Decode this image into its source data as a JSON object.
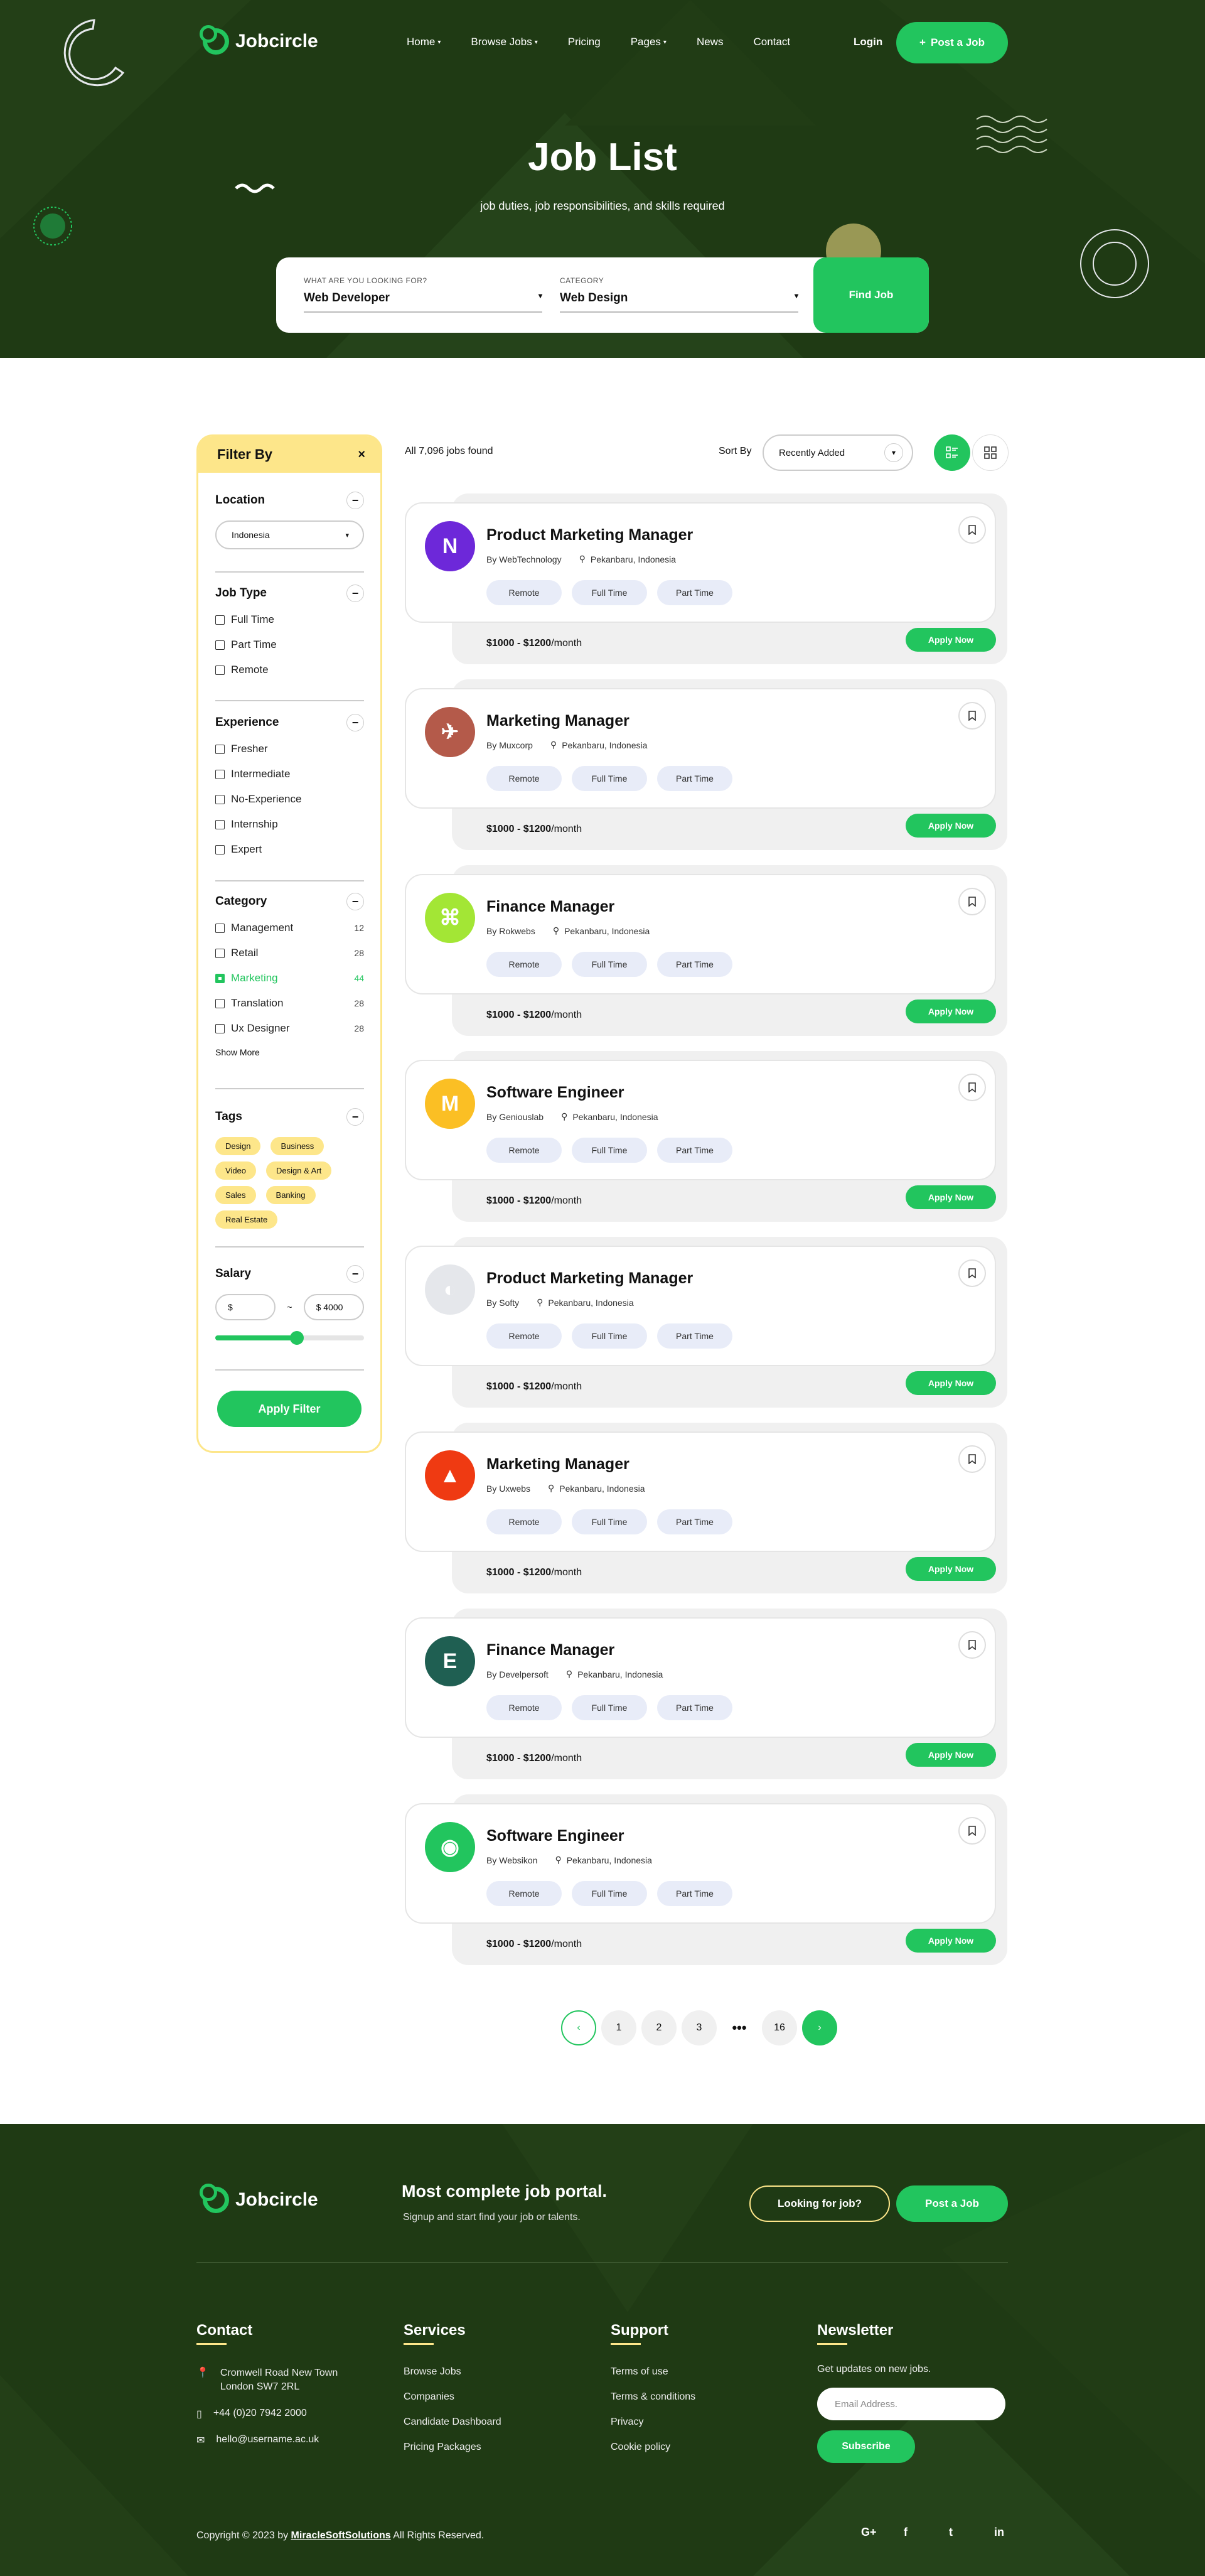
{
  "brand": "Jobcircle",
  "nav": {
    "items": [
      "Home",
      "Browse Jobs",
      "Pricing",
      "Pages",
      "News",
      "Contact"
    ],
    "has_dropdown": [
      true,
      true,
      false,
      true,
      false,
      false
    ],
    "login": "Login",
    "post_job": "Post a Job"
  },
  "hero": {
    "title": "Job List",
    "subtitle": "job duties, job responsibilities, and skills required"
  },
  "search": {
    "what_label": "WHAT ARE YOU LOOKING FOR?",
    "what_value": "Web Developer",
    "category_label": "CATEGORY",
    "category_value": "Web Design",
    "find_button": "Find Job"
  },
  "filter": {
    "title": "Filter By",
    "location": {
      "heading": "Location",
      "value": "Indonesia"
    },
    "job_type": {
      "heading": "Job Type",
      "options": [
        "Full Time",
        "Part Time",
        "Remote"
      ]
    },
    "experience": {
      "heading": "Experience",
      "options": [
        "Fresher",
        "Intermediate",
        "No-Experience",
        "Internship",
        "Expert"
      ]
    },
    "category": {
      "heading": "Category",
      "options": [
        {
          "label": "Management",
          "count": "12",
          "checked": false
        },
        {
          "label": "Retail",
          "count": "28",
          "checked": false
        },
        {
          "label": "Marketing",
          "count": "44",
          "checked": true
        },
        {
          "label": "Translation",
          "count": "28",
          "checked": false
        },
        {
          "label": "Ux Designer",
          "count": "28",
          "checked": false
        }
      ],
      "show_more": "Show More"
    },
    "tags": {
      "heading": "Tags",
      "items": [
        "Design",
        "Business",
        "Video",
        "Design & Art",
        "Sales",
        "Banking",
        "Real Estate"
      ]
    },
    "salary": {
      "heading": "Salary",
      "min": "$",
      "separator": "~",
      "max": "$ 4000",
      "range_fraction": 0.55
    },
    "apply": "Apply Filter"
  },
  "results": {
    "count_text": "All 7,096 jobs found",
    "sort_label": "Sort By",
    "sort_value": "Recently Added"
  },
  "jobs": [
    {
      "title": "Product Marketing Manager",
      "company": "By WebTechnology",
      "location": "Pekanbaru, Indonesia",
      "tags": [
        "Remote",
        "Full Time",
        "Part Time"
      ],
      "salary_range": "$1000 - $1200",
      "salary_unit": "/month",
      "apply": "Apply Now",
      "logo_color": "#6d28d9",
      "logo_glyph": "N"
    },
    {
      "title": "Marketing Manager",
      "company": "By Muxcorp",
      "location": "Pekanbaru, Indonesia",
      "tags": [
        "Remote",
        "Full Time",
        "Part Time"
      ],
      "salary_range": "$1000 - $1200",
      "salary_unit": "/month",
      "apply": "Apply Now",
      "logo_color": "#b45a4a",
      "logo_glyph": "✈"
    },
    {
      "title": "Finance Manager",
      "company": "By Rokwebs",
      "location": "Pekanbaru, Indonesia",
      "tags": [
        "Remote",
        "Full Time",
        "Part Time"
      ],
      "salary_range": "$1000 - $1200",
      "salary_unit": "/month",
      "apply": "Apply Now",
      "logo_color": "#a3e635",
      "logo_glyph": "⌘"
    },
    {
      "title": "Software Engineer",
      "company": "By Geniouslab",
      "location": "Pekanbaru, Indonesia",
      "tags": [
        "Remote",
        "Full Time",
        "Part Time"
      ],
      "salary_range": "$1000 - $1200",
      "salary_unit": "/month",
      "apply": "Apply Now",
      "logo_color": "#fbbf24",
      "logo_glyph": "M"
    },
    {
      "title": "Product Marketing Manager",
      "company": "By Softy",
      "location": "Pekanbaru, Indonesia",
      "tags": [
        "Remote",
        "Full Time",
        "Part Time"
      ],
      "salary_range": "$1000 - $1200",
      "salary_unit": "/month",
      "apply": "Apply Now",
      "logo_color": "#e5e7eb",
      "logo_glyph": "◐"
    },
    {
      "title": "Marketing Manager",
      "company": "By Uxwebs",
      "location": "Pekanbaru, Indonesia",
      "tags": [
        "Remote",
        "Full Time",
        "Part Time"
      ],
      "salary_range": "$1000 - $1200",
      "salary_unit": "/month",
      "apply": "Apply Now",
      "logo_color": "#ef3a12",
      "logo_glyph": "▲"
    },
    {
      "title": "Finance Manager",
      "company": "By Develpersoft",
      "location": "Pekanbaru, Indonesia",
      "tags": [
        "Remote",
        "Full Time",
        "Part Time"
      ],
      "salary_range": "$1000 - $1200",
      "salary_unit": "/month",
      "apply": "Apply Now",
      "logo_color": "#1f5f52",
      "logo_glyph": "E"
    },
    {
      "title": "Software Engineer",
      "company": "By Websikon",
      "location": "Pekanbaru, Indonesia",
      "tags": [
        "Remote",
        "Full Time",
        "Part Time"
      ],
      "salary_range": "$1000 - $1200",
      "salary_unit": "/month",
      "apply": "Apply Now",
      "logo_color": "#22c55e",
      "logo_glyph": "◉"
    }
  ],
  "pagination": {
    "prev": "‹",
    "pages": [
      "1",
      "2",
      "3"
    ],
    "ellipsis": "•••",
    "last": "16",
    "next": "›"
  },
  "footer": {
    "tagline": "Most complete job portal.",
    "tagline_sub": "Signup and start find your job or talents.",
    "looking": "Looking for job?",
    "post": "Post a Job",
    "contact": {
      "heading": "Contact",
      "address": "Cromwell Road New Town London SW7 2RL",
      "phone": "+44 (0)20 7942 2000",
      "email": "hello@username.ac.uk"
    },
    "services": {
      "heading": "Services",
      "links": [
        "Browse Jobs",
        "Companies",
        "Candidate Dashboard",
        "Pricing Packages"
      ]
    },
    "support": {
      "heading": "Support",
      "links": [
        "Terms of use",
        "Terms & conditions",
        "Privacy",
        "Cookie policy"
      ]
    },
    "newsletter": {
      "heading": "Newsletter",
      "text": "Get updates on new jobs.",
      "placeholder": "Email Address.",
      "button": "Subscribe"
    },
    "copyright_prefix": "Copyright © 2023 by",
    "copyright_link": "MiracleSoftSolutions",
    "copyright_suffix": "All Rights Reserved.",
    "social": [
      "G+",
      "f",
      "t",
      "in"
    ]
  },
  "colors": {
    "primary": "#22c55e",
    "dark": "#1f3a14",
    "accent": "#fde68a",
    "chip": "#e8ecf8"
  }
}
